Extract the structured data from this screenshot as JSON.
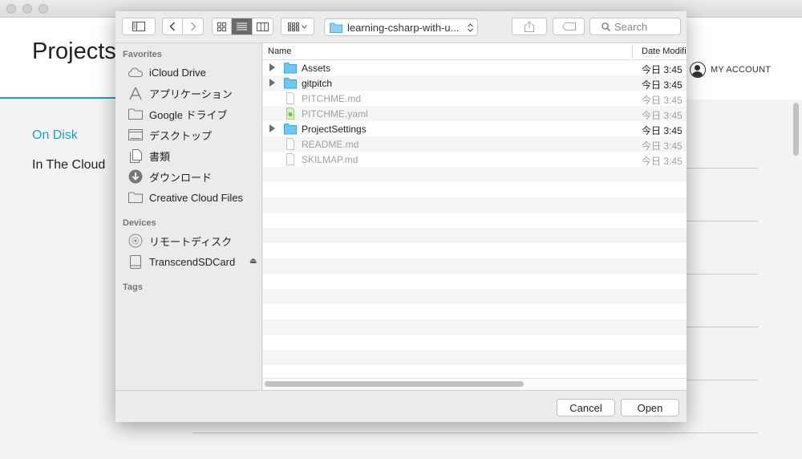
{
  "app": {
    "title": "Projects",
    "account_label": "MY ACCOUNT",
    "nav": [
      {
        "label": "On Disk",
        "active": true
      },
      {
        "label": "In The Cloud",
        "active": false
      }
    ],
    "accent_color": "#1fa0c0"
  },
  "dialog": {
    "toolbar": {
      "path": "learning-csharp-with-u...",
      "search_placeholder": "Search"
    },
    "sidebar": {
      "favorites_heading": "Favorites",
      "favorites": [
        {
          "label": "iCloud Drive",
          "icon": "cloud-icon"
        },
        {
          "label": "アプリケーション",
          "icon": "applications-icon"
        },
        {
          "label": "Google ドライブ",
          "icon": "folder-icon"
        },
        {
          "label": "デスクトップ",
          "icon": "desktop-icon"
        },
        {
          "label": "書類",
          "icon": "documents-icon"
        },
        {
          "label": "ダウンロード",
          "icon": "download-icon"
        },
        {
          "label": "Creative Cloud Files",
          "icon": "folder-icon"
        }
      ],
      "devices_heading": "Devices",
      "devices": [
        {
          "label": "リモートディスク",
          "icon": "disc-icon"
        },
        {
          "label": "TranscendSDCard",
          "icon": "drive-icon"
        }
      ],
      "tags_heading": "Tags"
    },
    "columns": {
      "name": "Name",
      "date": "Date Modifi"
    },
    "files": [
      {
        "name": "Assets",
        "date": "今日 3:45",
        "kind": "folder",
        "dim": false
      },
      {
        "name": "gitpitch",
        "date": "今日 3:45",
        "kind": "folder",
        "dim": false
      },
      {
        "name": "PITCHME.md",
        "date": "今日 3:45",
        "kind": "file",
        "dim": true
      },
      {
        "name": "PITCHME.yaml",
        "date": "今日 3:45",
        "kind": "yaml",
        "dim": true
      },
      {
        "name": "ProjectSettings",
        "date": "今日 3:45",
        "kind": "folder",
        "dim": false
      },
      {
        "name": "README.md",
        "date": "今日 3:45",
        "kind": "file",
        "dim": true
      },
      {
        "name": "SKILMAP.md",
        "date": "今日 3:45",
        "kind": "file",
        "dim": true
      }
    ],
    "buttons": {
      "cancel": "Cancel",
      "open": "Open"
    }
  }
}
